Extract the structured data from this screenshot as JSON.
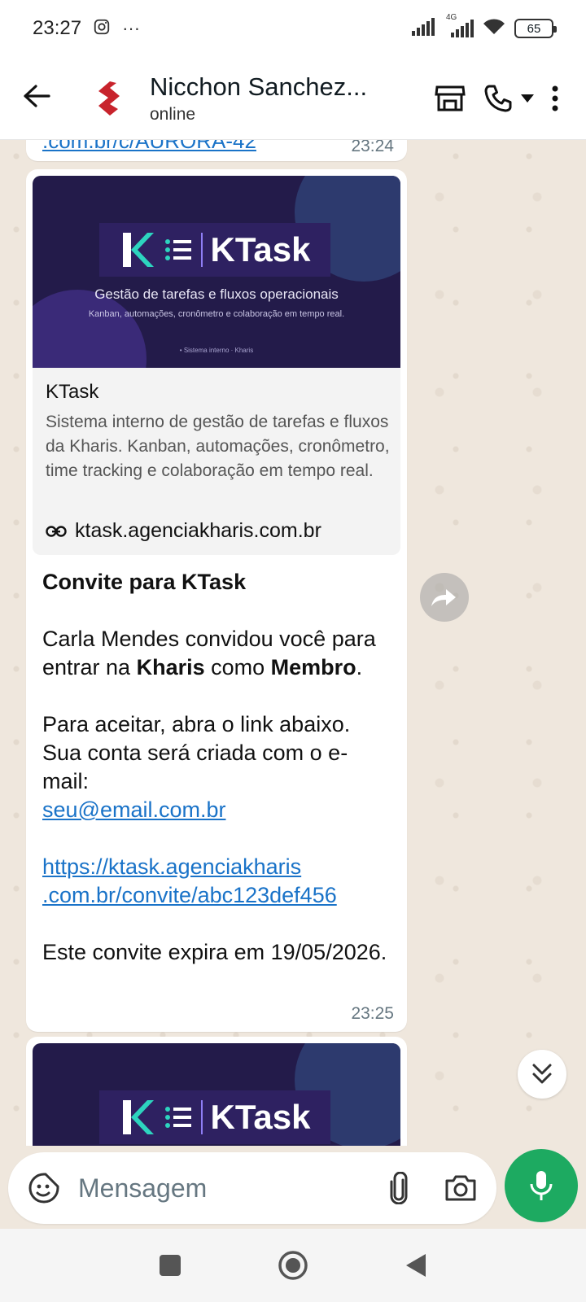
{
  "status_bar": {
    "time": "23:27",
    "dots": "···",
    "network": "4G",
    "battery": "65"
  },
  "header": {
    "contact_name": "Nicchon Sanchez...",
    "status": "online"
  },
  "messages": {
    "previous": {
      "link_fragment": ".com.br/c/AURORA-42",
      "time": "23:24"
    },
    "main": {
      "preview": {
        "banner_brand": "KTask",
        "banner_title": "Gestão de tarefas e fluxos operacionais",
        "banner_subtitle": "Kanban, automações, cronômetro e colaboração em tempo real.",
        "banner_footer": "• Sistema interno · Kharis",
        "title": "KTask",
        "description": "Sistema interno de gestão de tarefas e fluxos da Kharis. Kanban, automações, cronômetro, time tracking e colaboração em tempo real.",
        "url": "ktask.agenciakharis.com.br"
      },
      "heading": "Convite para KTask",
      "invite_prefix": "Carla Mendes convidou você para entrar na ",
      "invite_org": "Kharis",
      "invite_mid": " como ",
      "invite_role": "Membro",
      "invite_end": ".",
      "accept_line": "Para aceitar, abra o link abaixo. Sua conta será criada com o e-mail:",
      "email": "seu@email.com.br",
      "invite_link_1": "https://ktask.agenciakharis",
      "invite_link_2": ".com.br/convite/abc123def456",
      "expiry": "Este convite expira em 19/05/2026.",
      "time": "23:25"
    }
  },
  "composer": {
    "placeholder": "Mensagem"
  },
  "colors": {
    "accent_green": "#1daa61",
    "link_blue": "#1a73c8",
    "chat_bg": "#efe7dd",
    "banner_bg": "#231b4a"
  }
}
